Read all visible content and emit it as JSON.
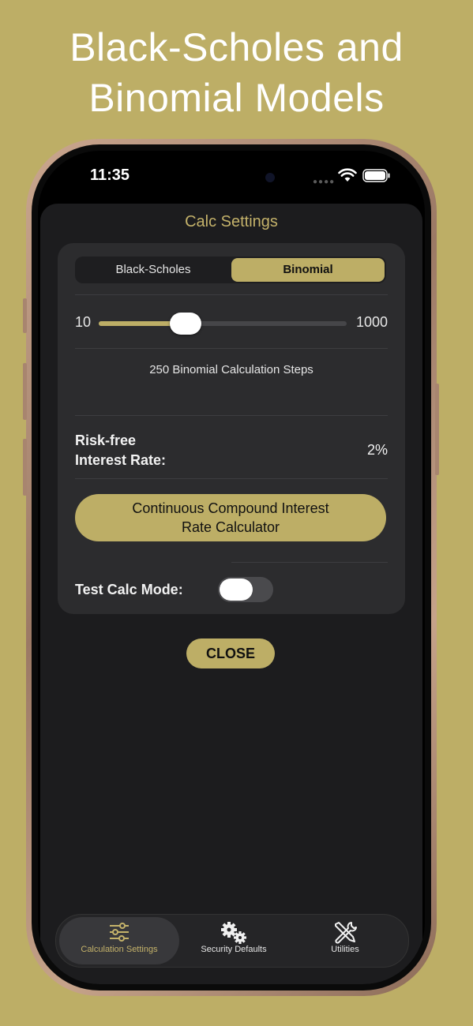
{
  "headline": {
    "line1": "Black-Scholes and",
    "line2": "Binomial Models"
  },
  "status_bar": {
    "time": "11:35"
  },
  "sheet": {
    "title": "Calc Settings"
  },
  "model_selector": {
    "options": [
      "Black-Scholes",
      "Binomial"
    ],
    "selected": "Binomial"
  },
  "steps_slider": {
    "min_label": "10",
    "max_label": "1000",
    "value": 250,
    "min": 10,
    "max": 1000,
    "caption": "250 Binomial Calculation Steps"
  },
  "interest_rate": {
    "label_line1": "Risk-free",
    "label_line2": "Interest Rate:",
    "value": "2%"
  },
  "calculator_button": {
    "line1": "Continuous Compound Interest",
    "line2": "Rate Calculator"
  },
  "test_mode": {
    "label": "Test Calc Mode:",
    "enabled": false
  },
  "close_button": {
    "label": "CLOSE"
  },
  "tabs": [
    {
      "label": "Calculation Settings",
      "icon": "sliders-icon",
      "active": true
    },
    {
      "label": "Security Defaults",
      "icon": "gears-icon",
      "active": false
    },
    {
      "label": "Utilities",
      "icon": "tools-icon",
      "active": false
    }
  ],
  "colors": {
    "accent": "#bdae66",
    "background": "#bdae66",
    "sheet": "#1c1c1e",
    "card": "#2c2c2e"
  }
}
